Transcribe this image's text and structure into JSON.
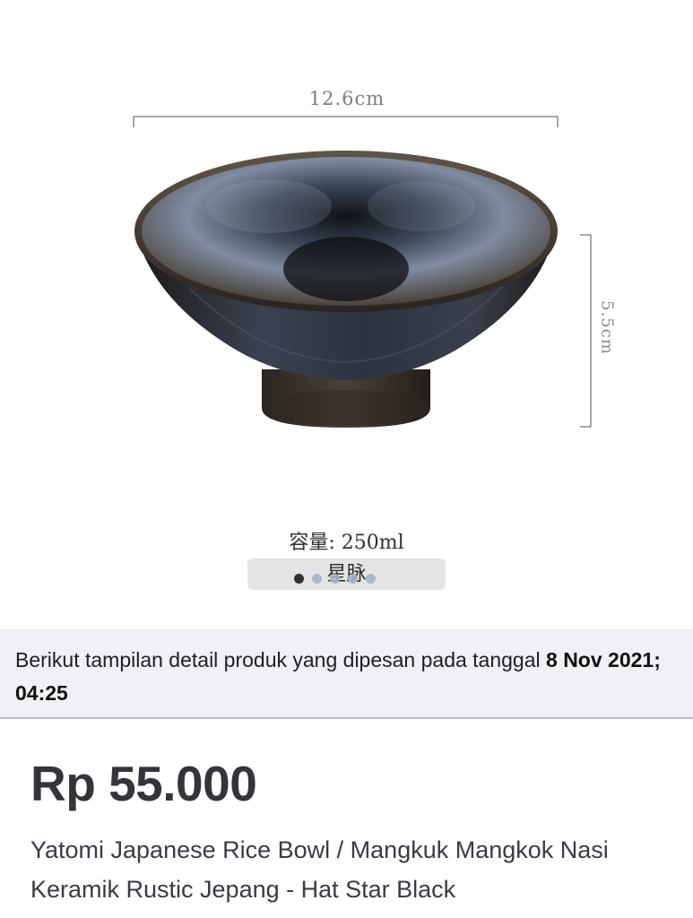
{
  "product_image": {
    "dimension_width": "12.6cm",
    "dimension_height": "5.5cm",
    "capacity": "容量: 250ml",
    "pattern_name": "星脉",
    "carousel": {
      "total": 5,
      "active_index": 0
    }
  },
  "order_info": {
    "text": "Berikut tampilan detail produk yang dipesan pada tanggal ",
    "date": "8 Nov 2021; 04:25"
  },
  "product": {
    "price": "Rp 55.000",
    "name": "Yatomi Japanese Rice Bowl / Mangkuk Mangkok Nasi Keramik Rustic Jepang - Hat Star Black"
  },
  "colors": {
    "bowl_glaze": "#2a2e37",
    "bowl_highlight": "#8a97ab",
    "banner_bg": "#f0f1f5",
    "price_text": "#33353b"
  }
}
